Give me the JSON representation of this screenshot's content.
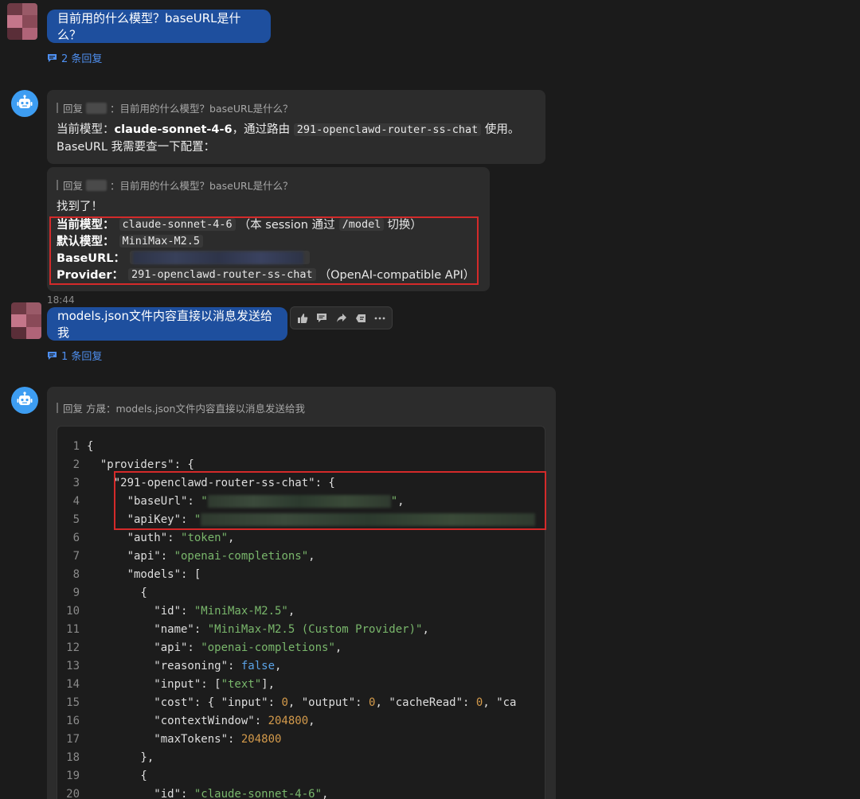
{
  "messages": {
    "q1": {
      "text": "目前用的什么模型？baseURL是什么？",
      "replies": "2 条回复"
    },
    "r1": {
      "quote_prefix": "回复",
      "quote_text": "：目前用的什么模型？baseURL是什么？",
      "line1_a": "当前模型：",
      "line1_model": "claude-sonnet-4-6",
      "line1_b": "，通过路由",
      "line1_router": "291-openclawd-router-ss-chat",
      "line1_c": "使用。",
      "line2": "BaseURL 我需要查一下配置："
    },
    "r2": {
      "quote_prefix": "回复",
      "quote_text": "：目前用的什么模型？baseURL是什么？",
      "found": "找到了！",
      "rows": [
        {
          "label": "当前模型：",
          "value": "claude-sonnet-4-6",
          "note_a": "（本 session 通过",
          "note_code": "/model",
          "note_b": "切换）"
        },
        {
          "label": "默认模型：",
          "value": "MiniMax-M2.5"
        },
        {
          "label": "BaseURL："
        },
        {
          "label": "Provider：",
          "value": "291-openclawd-router-ss-chat",
          "note": "（OpenAI-compatible API）"
        }
      ],
      "time": "18:44"
    },
    "q2": {
      "text": "models.json文件内容直接以消息发送给我",
      "replies": "1 条回复"
    },
    "r3": {
      "quote_prefix": "回复 方晟：",
      "quote_text": "models.json文件内容直接以消息发送给我"
    }
  },
  "toolbar_icons": [
    "thumbs-up-icon",
    "comment-icon",
    "share-icon",
    "quote-icon",
    "more-icon"
  ],
  "code": {
    "lines": [
      [
        [
          "k",
          "{"
        ]
      ],
      [
        [
          "k",
          "  \"providers\": {"
        ]
      ],
      [
        [
          "k",
          "    \"291-openclawd-router-ss-chat\": {"
        ]
      ],
      [
        [
          "k",
          "      \"baseUrl\": "
        ],
        [
          "s",
          "\""
        ],
        [
          "blur",
          "230"
        ],
        [
          "s",
          "\""
        ],
        [
          "k",
          ","
        ]
      ],
      [
        [
          "k",
          "      \"apiKey\": "
        ],
        [
          "s",
          "\""
        ],
        [
          "blur",
          "420"
        ]
      ],
      [
        [
          "k",
          "      \"auth\": "
        ],
        [
          "s",
          "\"token\""
        ],
        [
          "k",
          ","
        ]
      ],
      [
        [
          "k",
          "      \"api\": "
        ],
        [
          "s",
          "\"openai-completions\""
        ],
        [
          "k",
          ","
        ]
      ],
      [
        [
          "k",
          "      \"models\": ["
        ]
      ],
      [
        [
          "k",
          "        {"
        ]
      ],
      [
        [
          "k",
          "          \"id\": "
        ],
        [
          "s",
          "\"MiniMax-M2.5\""
        ],
        [
          "k",
          ","
        ]
      ],
      [
        [
          "k",
          "          \"name\": "
        ],
        [
          "s",
          "\"MiniMax-M2.5 (Custom Provider)\""
        ],
        [
          "k",
          ","
        ]
      ],
      [
        [
          "k",
          "          \"api\": "
        ],
        [
          "s",
          "\"openai-completions\""
        ],
        [
          "k",
          ","
        ]
      ],
      [
        [
          "k",
          "          \"reasoning\": "
        ],
        [
          "kw",
          "false"
        ],
        [
          "k",
          ","
        ]
      ],
      [
        [
          "k",
          "          \"input\": ["
        ],
        [
          "s",
          "\"text\""
        ],
        [
          "k",
          "],"
        ]
      ],
      [
        [
          "k",
          "          \"cost\": { \"input\": "
        ],
        [
          "n",
          "0"
        ],
        [
          "k",
          ", \"output\": "
        ],
        [
          "n",
          "0"
        ],
        [
          "k",
          ", \"cacheRead\": "
        ],
        [
          "n",
          "0"
        ],
        [
          "k",
          ", \"ca"
        ]
      ],
      [
        [
          "k",
          "          \"contextWindow\": "
        ],
        [
          "n",
          "204800"
        ],
        [
          "k",
          ","
        ]
      ],
      [
        [
          "k",
          "          \"maxTokens\": "
        ],
        [
          "n",
          "204800"
        ]
      ],
      [
        [
          "k",
          "        },"
        ]
      ],
      [
        [
          "k",
          "        {"
        ]
      ],
      [
        [
          "k",
          "          \"id\": "
        ],
        [
          "s",
          "\"claude-sonnet-4-6\""
        ],
        [
          "k",
          ","
        ]
      ]
    ]
  }
}
